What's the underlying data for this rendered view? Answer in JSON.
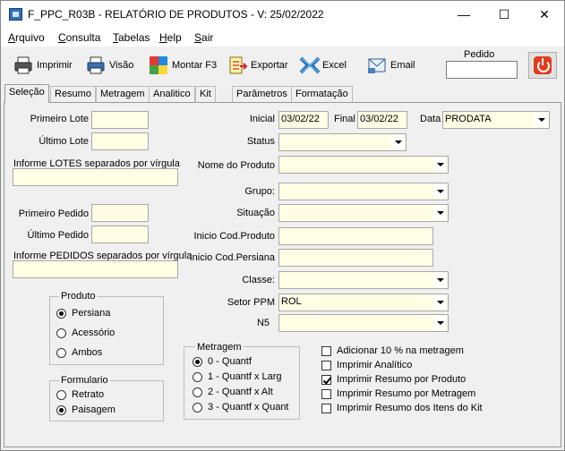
{
  "window": {
    "title": "F_PPC_R03B - RELATÓRIO DE PRODUTOS - V: 25/02/2022",
    "minimize_glyph": "—",
    "maximize_glyph": "☐",
    "close_glyph": "✕"
  },
  "menu": [
    {
      "key": "A",
      "rest": "rquivo"
    },
    {
      "key": "C",
      "rest": "onsulta"
    },
    {
      "key": "T",
      "rest": "abelas"
    },
    {
      "key": "H",
      "rest": "elp"
    },
    {
      "key": "S",
      "rest": "air"
    }
  ],
  "toolbar": {
    "imprimir": "Imprimir",
    "visao": "Visão",
    "montar": "Montar F3",
    "exportar": "Exportar",
    "excel": "Excel",
    "email": "Email",
    "pedido_label": "Pedido",
    "pedido_value": ""
  },
  "tabs": [
    "Seleção",
    "Resumo",
    "Metragem",
    "Analitico",
    "Kit",
    "Parâmetros",
    "Formatação"
  ],
  "left": {
    "primeiro_lote": "Primeiro Lote",
    "ultimo_lote": "Último Lote",
    "informe_lotes": "Informe LOTES separados por vírgula",
    "primeiro_pedido": "Primeiro Pedido",
    "ultimo_pedido": "Último Pedido",
    "informe_pedidos": "Informe PEDIDOS separados por vírgula"
  },
  "right": {
    "inicial_label": "Inicial",
    "inicial_value": "03/02/22",
    "final_label": "Final",
    "final_value": "03/02/22",
    "data_label": "Data",
    "data_value": "PRODATA",
    "status": "Status",
    "nome_produto": "Nome do Produto",
    "grupo": "Grupo:",
    "situacao": "Situação",
    "inicio_cod_produto": "Inicio Cod.Produto",
    "inicio_cod_persiana": "Inicio Cod.Persiana",
    "classe": "Classe:",
    "setor_ppm": "Setor PPM",
    "setor_ppm_value": "ROL",
    "n5": "N5"
  },
  "produto": {
    "title": "Produto",
    "options": [
      "Persiana",
      "Acessório",
      "Ambos"
    ],
    "selected": 0
  },
  "formulario": {
    "title": "Formulario",
    "options": [
      "Retrato",
      "Paisagem"
    ],
    "selected": 1
  },
  "metragem": {
    "title": "Metragem",
    "options": [
      "0 - Quantf",
      "1 - Quantf x Larg",
      "2 - Quantf x Alt",
      "3 - Quantf x Quant"
    ],
    "selected": 0
  },
  "checks": [
    {
      "label": "Adicionar 10 % na metragem",
      "checked": false
    },
    {
      "label": "Imprimir Analítico",
      "checked": false
    },
    {
      "label": "Imprimir Resumo por Produto",
      "checked": true
    },
    {
      "label": "Imprimir Resumo por Metragem",
      "checked": false
    },
    {
      "label": "Imprimir Resumo dos Itens do Kit",
      "checked": false
    }
  ],
  "icons": [
    "app-icon",
    "printer-icon",
    "preview-printer-icon",
    "puzzle-icon",
    "export-document-icon",
    "excel-icon",
    "email-icon",
    "power-icon"
  ]
}
